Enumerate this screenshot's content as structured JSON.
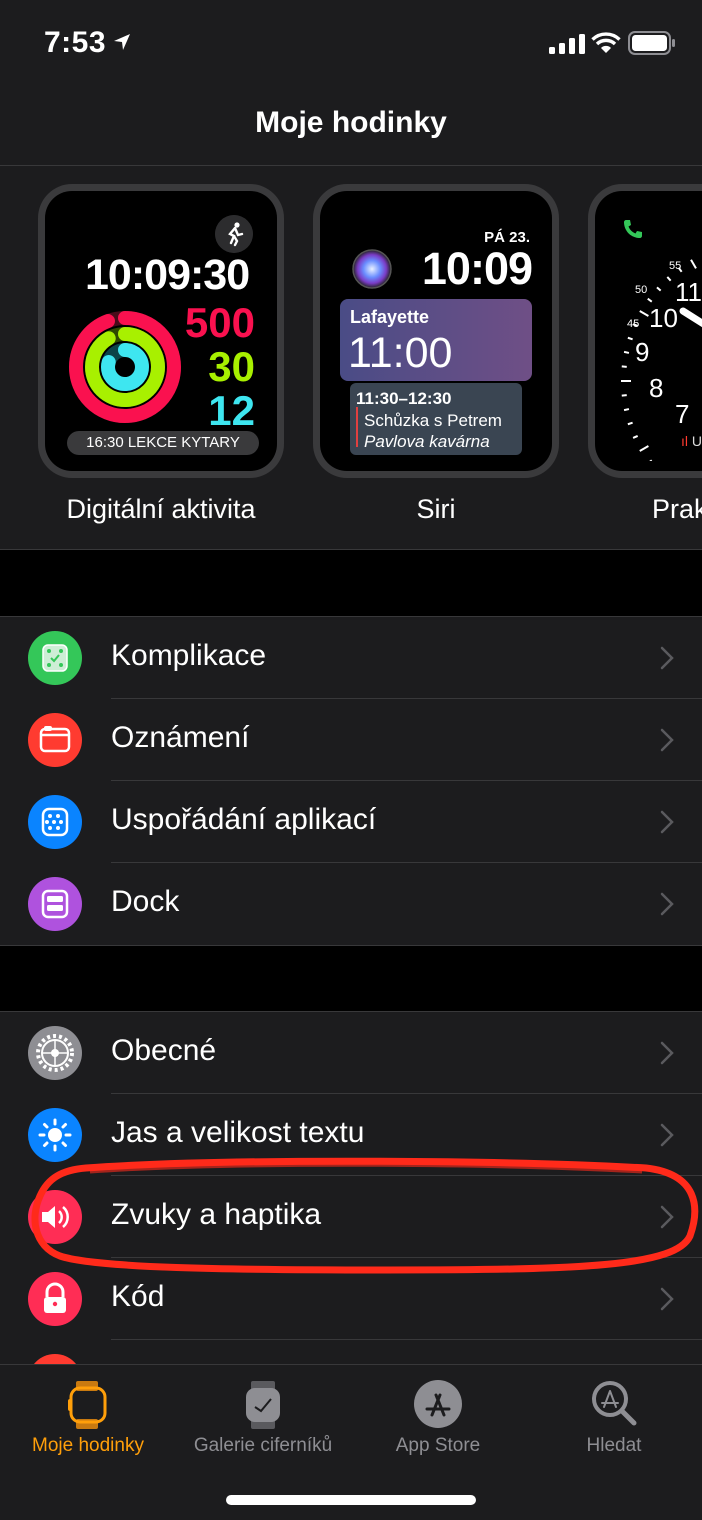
{
  "status_bar": {
    "time": "7:53"
  },
  "nav": {
    "title": "Moje hodinky"
  },
  "faces": [
    {
      "name": "Digitální aktivita",
      "time": "10:09:30",
      "move": "500",
      "exercise": "30",
      "stand": "12",
      "event": "16:30 LEKCE KYTARY"
    },
    {
      "name": "Siri",
      "date": "PÁ 23.",
      "time": "10:09",
      "card_title": "Lafayette",
      "card_time": "11:00",
      "event_time": "11:30–12:30",
      "event_title": "Schůzka s Petrem",
      "event_place": "Pavlova kavárna"
    },
    {
      "name": "Prak",
      "numbers": [
        "55",
        "50",
        "45",
        "11",
        "10",
        "9",
        "8",
        "7"
      ],
      "indicator": "U"
    }
  ],
  "group1": [
    {
      "label": "Komplikace",
      "icon": "complications-icon",
      "color": "#34c759"
    },
    {
      "label": "Oznámení",
      "icon": "notifications-icon",
      "color": "#ff3b30"
    },
    {
      "label": "Uspořádání aplikací",
      "icon": "app-layout-icon",
      "color": "#0a84ff"
    },
    {
      "label": "Dock",
      "icon": "dock-icon",
      "color": "#af52de"
    }
  ],
  "group2": [
    {
      "label": "Obecné",
      "icon": "gear-icon",
      "color": "#8e8e93"
    },
    {
      "label": "Jas a velikost textu",
      "icon": "brightness-icon",
      "color": "#0a84ff"
    },
    {
      "label": "Zvuky a haptika",
      "icon": "sound-icon",
      "color": "#ff2d55"
    },
    {
      "label": "Kód",
      "icon": "lock-icon",
      "color": "#ff2d55"
    }
  ],
  "tabs": [
    {
      "label": "Moje hodinky",
      "icon": "watch-icon",
      "active": true
    },
    {
      "label": "Galerie ciferníků",
      "icon": "watch-faces-icon",
      "active": false
    },
    {
      "label": "App Store",
      "icon": "app-store-icon",
      "active": false
    },
    {
      "label": "Hledat",
      "icon": "search-icon",
      "active": false
    }
  ],
  "colors": {
    "accent": "#ff9f0a",
    "annotation": "#ff2a1a",
    "background": "#1c1c1e"
  }
}
